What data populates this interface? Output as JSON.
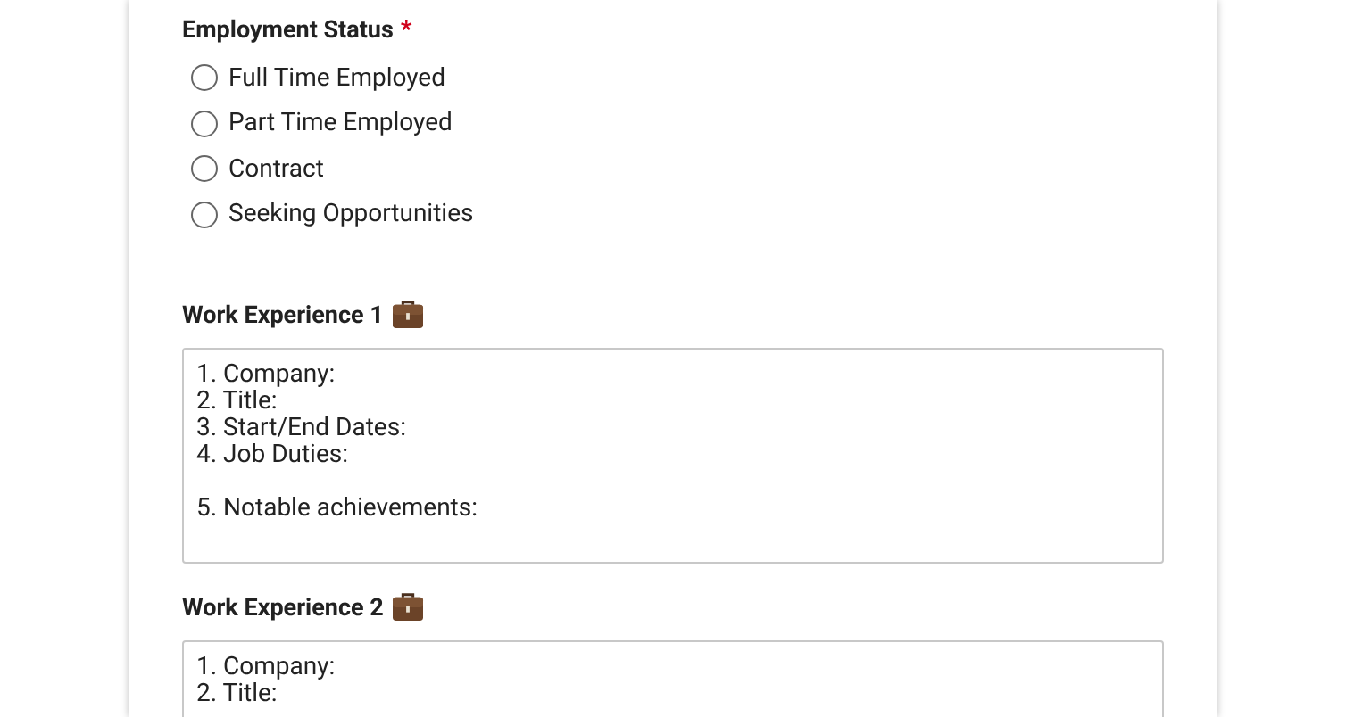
{
  "employment_status": {
    "label": "Employment Status",
    "required_mark": "*",
    "options": [
      {
        "label": "Full Time Employed",
        "selected": false
      },
      {
        "label": "Part Time Employed",
        "selected": false
      },
      {
        "label": "Contract",
        "selected": false
      },
      {
        "label": "Seeking Opportunities",
        "selected": false
      }
    ]
  },
  "work_experience": [
    {
      "label": "Work Experience 1",
      "value": "1. Company:\n2. Title:\n3. Start/End Dates:\n4. Job Duties:\n\n5. Notable achievements:"
    },
    {
      "label": "Work Experience 2",
      "value": "1. Company:\n2. Title:"
    }
  ]
}
